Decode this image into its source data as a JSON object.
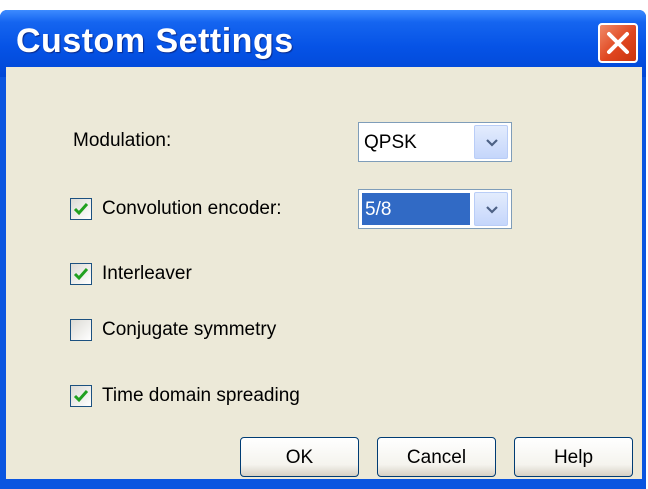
{
  "window": {
    "title": "Custom Settings"
  },
  "modulation": {
    "label": "Modulation:",
    "value": "QPSK"
  },
  "convolution": {
    "label": "Convolution encoder:",
    "checked": true,
    "value": "5/8"
  },
  "interleaver": {
    "label": "Interleaver",
    "checked": true
  },
  "conjugate": {
    "label": "Conjugate symmetry",
    "checked": false
  },
  "spreading": {
    "label": "Time domain spreading",
    "checked": true
  },
  "buttons": {
    "ok": "OK",
    "cancel": "Cancel",
    "help": "Help"
  },
  "colors": {
    "titlebar": "#0653e6",
    "dialog": "#ece9d8",
    "check": "#21a121",
    "selection": "#316ac5",
    "close": "#e0461f"
  },
  "icons": {
    "close": "close-icon",
    "dropdown": "chevron-down-icon",
    "check": "check-icon"
  }
}
